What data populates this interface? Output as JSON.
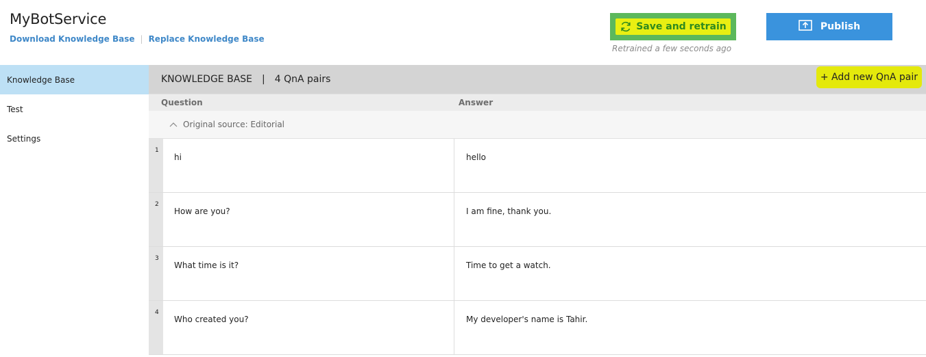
{
  "header": {
    "title": "MyBotService",
    "links": [
      "Download Knowledge Base",
      "Replace Knowledge Base"
    ],
    "save_label": "Save and retrain",
    "retrained_status": "Retrained a few seconds ago",
    "publish_label": "Publish"
  },
  "sidebar": {
    "items": [
      {
        "label": "Knowledge Base",
        "active": true
      },
      {
        "label": "Test",
        "active": false
      },
      {
        "label": "Settings",
        "active": false
      }
    ]
  },
  "main": {
    "kb_title": "KNOWLEDGE BASE",
    "pair_count": "4 QnA pairs",
    "add_label": "+ Add new QnA pair",
    "columns": {
      "question": "Question",
      "answer": "Answer"
    },
    "source_label": "Original source: Editorial",
    "rows": [
      {
        "num": "1",
        "question": "hi",
        "answer": "hello"
      },
      {
        "num": "2",
        "question": "How are you?",
        "answer": "I am fine, thank you."
      },
      {
        "num": "3",
        "question": "What time is it?",
        "answer": "Time to get a watch."
      },
      {
        "num": "4",
        "question": "Who created you?",
        "answer": "My developer's name is Tahir."
      }
    ]
  },
  "colors": {
    "save_bg": "#5cb85c",
    "highlight": "#e9ef12",
    "publish_bg": "#3a93dd",
    "link": "#3f88c8",
    "active_nav": "#bde0f5"
  }
}
